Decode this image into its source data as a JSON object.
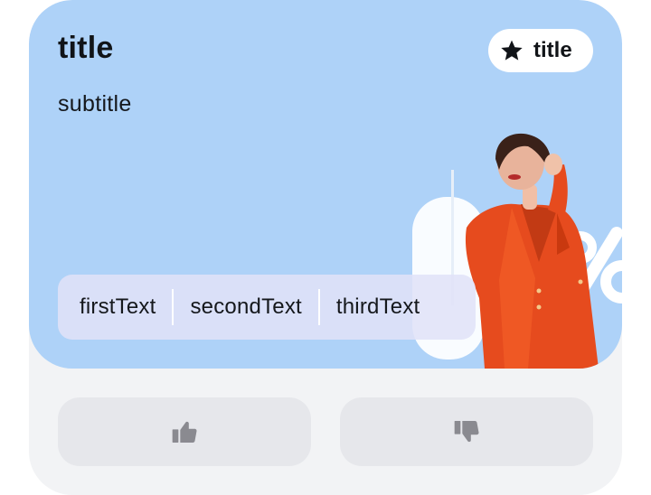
{
  "card": {
    "title": "title",
    "subtitle": "subtitle",
    "badge": {
      "icon": "star-icon",
      "label": "title"
    },
    "hero_background": "#aed2f8",
    "chips": [
      {
        "label": "firstText"
      },
      {
        "label": "secondText"
      },
      {
        "label": "thirdText"
      }
    ],
    "actions": {
      "like": {
        "icon": "thumbs-up-icon"
      },
      "dislike": {
        "icon": "thumbs-down-icon"
      }
    }
  }
}
